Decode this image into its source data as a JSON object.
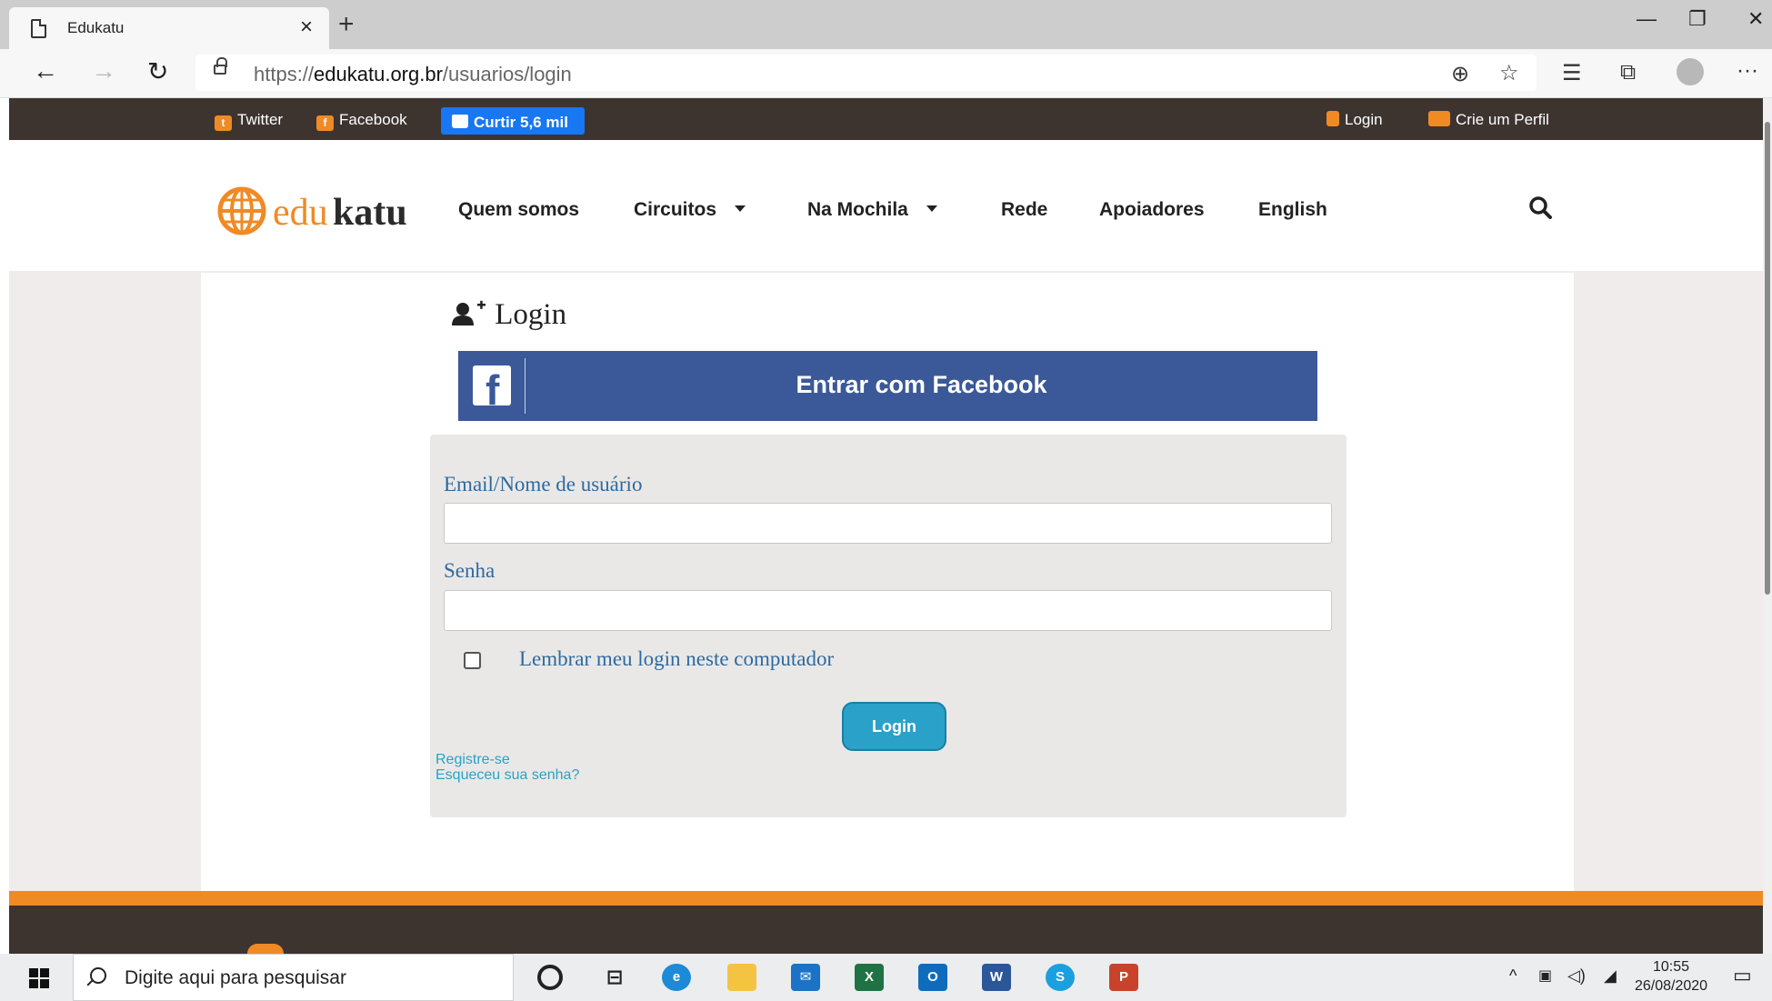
{
  "browser": {
    "tab_title": "Edukatu",
    "tab_close": "×",
    "new_tab": "+",
    "url_scheme": "https://",
    "url_domain": "edukatu.org.br",
    "url_path": "/usuarios/login",
    "window_minimize": "—",
    "window_restore": "❐",
    "window_close": "✕"
  },
  "top_strip": {
    "twitter_label": "Twitter",
    "facebook_label": "Facebook",
    "curtir_label": "Curtir 5,6 mil",
    "login_label": "Login",
    "create_profile_label": "Crie um Perfil"
  },
  "header": {
    "logo_edu": "edu",
    "logo_katu": "katu",
    "nav": {
      "quem_somos": "Quem somos",
      "circuitos": "Circuitos",
      "na_mochila": "Na Mochila",
      "rede": "Rede",
      "apoiadores": "Apoiadores",
      "english": "English"
    }
  },
  "login_page": {
    "heading": "Login",
    "facebook_button": "Entrar com Facebook",
    "email_label": "Email/Nome de usuário",
    "email_value": "",
    "password_label": "Senha",
    "password_value": "",
    "remember_label": "Lembrar meu login neste computador",
    "remember_checked": false,
    "submit_label": "Login",
    "register_link": "Registre-se",
    "forgot_link": "Esqueceu sua senha?"
  },
  "taskbar": {
    "search_placeholder": "Digite aqui para pesquisar",
    "time": "10:55",
    "date": "26/08/2020",
    "apps": [
      "cortana",
      "task-view",
      "edge",
      "file-explorer",
      "mail",
      "excel",
      "outlook",
      "word",
      "skype",
      "powerpoint"
    ]
  },
  "colors": {
    "brand_orange": "#f08a24",
    "brand_dark": "#3d3430",
    "facebook_blue": "#3b5998",
    "link_blue": "#2d6a9f",
    "button_cyan": "#2aa1c9"
  }
}
